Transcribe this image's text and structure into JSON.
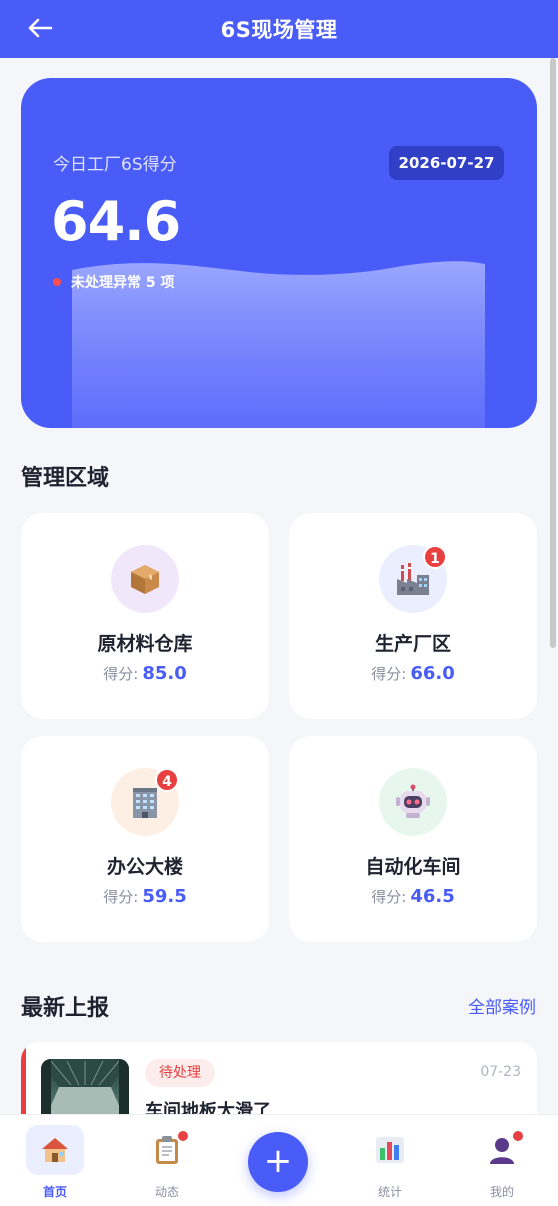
{
  "header": {
    "title": "6S现场管理",
    "back_icon": "arrow-left-icon"
  },
  "hero": {
    "label": "今日工厂6S得分",
    "date": "2026-07-27",
    "score": "64.6",
    "alert_text": "未处理异常 5 项"
  },
  "zones": {
    "title": "管理区域",
    "items": [
      {
        "name": "原材料仓库",
        "score_label": "得分:",
        "score": "85.0",
        "icon": "package-box-icon",
        "icon_bg": "#f1e7fb",
        "badge": ""
      },
      {
        "name": "生产厂区",
        "score_label": "得分:",
        "score": "66.0",
        "icon": "factory-icon",
        "icon_bg": "#eaeefe",
        "badge": "1"
      },
      {
        "name": "办公大楼",
        "score_label": "得分:",
        "score": "59.5",
        "icon": "office-building-icon",
        "icon_bg": "#fdefe4",
        "badge": "4"
      },
      {
        "name": "自动化车间",
        "score_label": "得分:",
        "score": "46.5",
        "icon": "robot-icon",
        "icon_bg": "#e7f7ee",
        "badge": ""
      }
    ]
  },
  "reports": {
    "title": "最新上报",
    "more": "全部案例",
    "items": [
      {
        "status": "待处理",
        "date": "07-23",
        "title": "车间地板太滑了"
      }
    ]
  },
  "tabbar": {
    "items": [
      {
        "label": "首页",
        "icon": "house-icon"
      },
      {
        "label": "动态",
        "icon": "clipboard-icon"
      },
      {
        "label": "统计",
        "icon": "bar-chart-icon"
      },
      {
        "label": "我的",
        "icon": "user-icon"
      }
    ],
    "fab_label": "+"
  },
  "colors": {
    "primary": "#4a5cf7",
    "danger": "#e84040",
    "background": "#f5f6fa"
  }
}
